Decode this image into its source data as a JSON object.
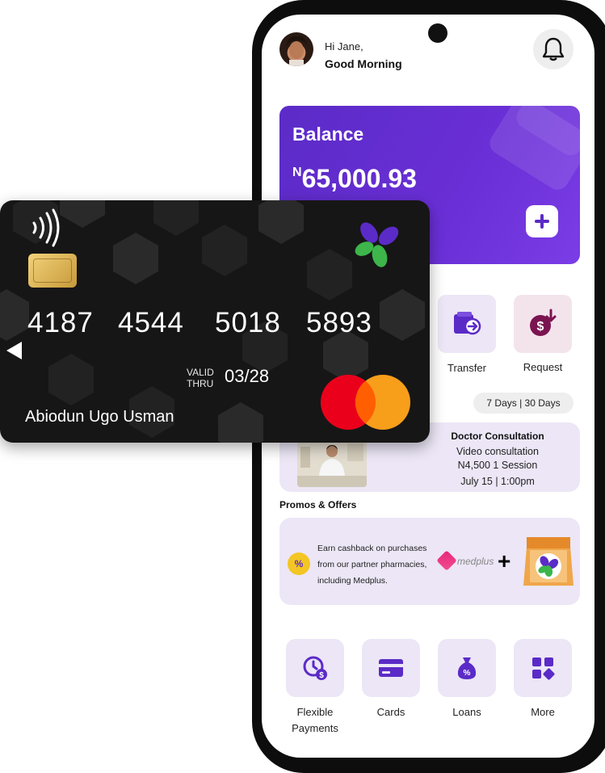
{
  "header": {
    "greeting": "Hi Jane,",
    "salutation": "Good Morning"
  },
  "balance": {
    "label": "Balance",
    "currency": "N",
    "amount": "65,000.93"
  },
  "actions": [
    {
      "label": "Transfer",
      "icon": "wallet-arrow-icon"
    },
    {
      "label": "Request",
      "icon": "money-request-icon"
    }
  ],
  "period_selector": {
    "text": "7 Days | 30 Days"
  },
  "appointment": {
    "title": "Doctor Consultation",
    "type": "Video consultation",
    "price": "N4,500  1 Session",
    "when": "July 15 | 1:00pm"
  },
  "promos": {
    "title": "Promos & Offers",
    "lines": [
      "Earn cashback on purchases",
      "from our partner pharmacies,",
      "including Medplus."
    ],
    "partner": "medplus",
    "badge": "%"
  },
  "bottom_menu": [
    {
      "label": "Flexible Payments",
      "icon": "clock-dollar-icon"
    },
    {
      "label": "Cards",
      "icon": "card-icon"
    },
    {
      "label": "Loans",
      "icon": "money-bag-icon"
    },
    {
      "label": "More",
      "icon": "grid-icon"
    }
  ],
  "card": {
    "number_groups": [
      "4187",
      "4544",
      "5018",
      "5893"
    ],
    "valid_label_1": "VALID",
    "valid_label_2": "THRU",
    "expiry": "03/28",
    "holder": "Abiodun Ugo Usman",
    "network": "mastercard"
  },
  "colors": {
    "primary": "#5b2bc7",
    "soft": "#ece6f6",
    "card_bg": "#161616",
    "green": "#3db54a"
  }
}
